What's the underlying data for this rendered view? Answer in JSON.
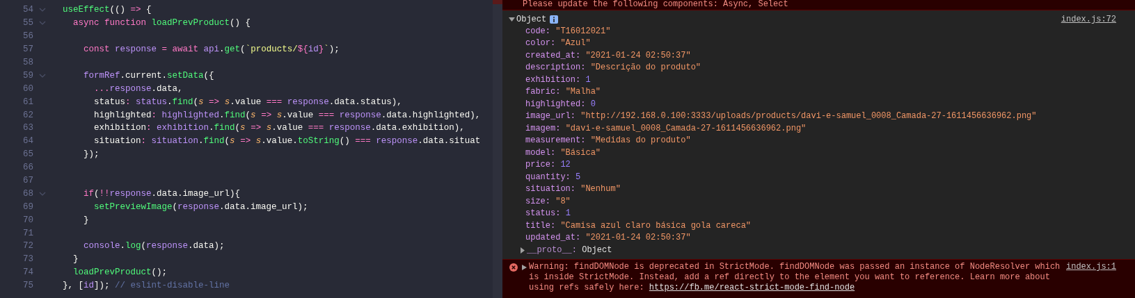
{
  "editor": {
    "lines": [
      {
        "number": "54",
        "foldable": true,
        "tokens": [
          {
            "kind": "func",
            "text": "useEffect"
          },
          {
            "kind": "plain",
            "text": "(() "
          },
          {
            "kind": "keyword",
            "text": "=>"
          },
          {
            "kind": "plain",
            "text": " {"
          }
        ]
      },
      {
        "number": "55",
        "foldable": true,
        "tokens": [
          {
            "kind": "keyword",
            "text": "  async function"
          },
          {
            "kind": "func",
            "text": " loadPrevProduct"
          },
          {
            "kind": "plain",
            "text": "() {"
          }
        ]
      },
      {
        "number": "56",
        "foldable": false
      },
      {
        "number": "57",
        "foldable": false,
        "tokens": [
          {
            "kind": "keyword",
            "text": "    const"
          },
          {
            "kind": "var",
            "text": " response"
          },
          {
            "kind": "keyword",
            "text": " ="
          },
          {
            "kind": "keyword",
            "text": " await"
          },
          {
            "kind": "var",
            "text": " api"
          },
          {
            "kind": "plain",
            "text": "."
          },
          {
            "kind": "func",
            "text": "get"
          },
          {
            "kind": "plain",
            "text": "("
          },
          {
            "kind": "string",
            "text": "`products/"
          },
          {
            "kind": "keyword",
            "text": "${"
          },
          {
            "kind": "var",
            "text": "id"
          },
          {
            "kind": "keyword",
            "text": "}"
          },
          {
            "kind": "string",
            "text": "`"
          },
          {
            "kind": "plain",
            "text": ");"
          }
        ]
      },
      {
        "number": "58",
        "foldable": false
      },
      {
        "number": "59",
        "foldable": true,
        "tokens": [
          {
            "kind": "var",
            "text": "    formRef"
          },
          {
            "kind": "plain",
            "text": ".current."
          },
          {
            "kind": "func",
            "text": "setData"
          },
          {
            "kind": "plain",
            "text": "({"
          }
        ]
      },
      {
        "number": "60",
        "foldable": false,
        "tokens": [
          {
            "kind": "keyword",
            "text": "      ..."
          },
          {
            "kind": "var",
            "text": "response"
          },
          {
            "kind": "plain",
            "text": ".data,"
          }
        ]
      },
      {
        "number": "61",
        "foldable": false,
        "tokens": [
          {
            "kind": "plain",
            "text": "      status"
          },
          {
            "kind": "keyword",
            "text": ": "
          },
          {
            "kind": "var",
            "text": "status"
          },
          {
            "kind": "plain",
            "text": "."
          },
          {
            "kind": "func",
            "text": "find"
          },
          {
            "kind": "plain",
            "text": "("
          },
          {
            "kind": "param",
            "text": "s"
          },
          {
            "kind": "keyword",
            "text": " => "
          },
          {
            "kind": "param",
            "text": "s"
          },
          {
            "kind": "plain",
            "text": ".value "
          },
          {
            "kind": "keyword",
            "text": "==="
          },
          {
            "kind": "var",
            "text": " response"
          },
          {
            "kind": "plain",
            "text": ".data.status),"
          }
        ]
      },
      {
        "number": "62",
        "foldable": false,
        "tokens": [
          {
            "kind": "plain",
            "text": "      highlighted"
          },
          {
            "kind": "keyword",
            "text": ": "
          },
          {
            "kind": "var",
            "text": "highlighted"
          },
          {
            "kind": "plain",
            "text": "."
          },
          {
            "kind": "func",
            "text": "find"
          },
          {
            "kind": "plain",
            "text": "("
          },
          {
            "kind": "param",
            "text": "s"
          },
          {
            "kind": "keyword",
            "text": " => "
          },
          {
            "kind": "param",
            "text": "s"
          },
          {
            "kind": "plain",
            "text": ".value "
          },
          {
            "kind": "keyword",
            "text": "==="
          },
          {
            "kind": "var",
            "text": " response"
          },
          {
            "kind": "plain",
            "text": ".data.highlighted),"
          }
        ]
      },
      {
        "number": "63",
        "foldable": false,
        "tokens": [
          {
            "kind": "plain",
            "text": "      exhibition"
          },
          {
            "kind": "keyword",
            "text": ": "
          },
          {
            "kind": "var",
            "text": "exhibition"
          },
          {
            "kind": "plain",
            "text": "."
          },
          {
            "kind": "func",
            "text": "find"
          },
          {
            "kind": "plain",
            "text": "("
          },
          {
            "kind": "param",
            "text": "s"
          },
          {
            "kind": "keyword",
            "text": " => "
          },
          {
            "kind": "param",
            "text": "s"
          },
          {
            "kind": "plain",
            "text": ".value "
          },
          {
            "kind": "keyword",
            "text": "==="
          },
          {
            "kind": "var",
            "text": " response"
          },
          {
            "kind": "plain",
            "text": ".data.exhibition),"
          }
        ]
      },
      {
        "number": "64",
        "foldable": false,
        "tokens": [
          {
            "kind": "plain",
            "text": "      situation"
          },
          {
            "kind": "keyword",
            "text": ": "
          },
          {
            "kind": "var",
            "text": "situation"
          },
          {
            "kind": "plain",
            "text": "."
          },
          {
            "kind": "func",
            "text": "find"
          },
          {
            "kind": "plain",
            "text": "("
          },
          {
            "kind": "param",
            "text": "s"
          },
          {
            "kind": "keyword",
            "text": " => "
          },
          {
            "kind": "param",
            "text": "s"
          },
          {
            "kind": "plain",
            "text": ".value."
          },
          {
            "kind": "func",
            "text": "toString"
          },
          {
            "kind": "plain",
            "text": "() "
          },
          {
            "kind": "keyword",
            "text": "==="
          },
          {
            "kind": "var",
            "text": " response"
          },
          {
            "kind": "plain",
            "text": ".data.situat"
          }
        ]
      },
      {
        "number": "65",
        "foldable": false,
        "tokens": [
          {
            "kind": "plain",
            "text": "    });"
          }
        ]
      },
      {
        "number": "66",
        "foldable": false
      },
      {
        "number": "67",
        "foldable": false
      },
      {
        "number": "68",
        "foldable": true,
        "tokens": [
          {
            "kind": "keyword",
            "text": "    if"
          },
          {
            "kind": "plain",
            "text": "("
          },
          {
            "kind": "keyword",
            "text": "!!"
          },
          {
            "kind": "var",
            "text": "response"
          },
          {
            "kind": "plain",
            "text": ".data.image_url){"
          }
        ]
      },
      {
        "number": "69",
        "foldable": false,
        "tokens": [
          {
            "kind": "func",
            "text": "      setPreviewImage"
          },
          {
            "kind": "plain",
            "text": "("
          },
          {
            "kind": "var",
            "text": "response"
          },
          {
            "kind": "plain",
            "text": ".data.image_url);"
          }
        ]
      },
      {
        "number": "70",
        "foldable": false,
        "tokens": [
          {
            "kind": "plain",
            "text": "    }"
          }
        ]
      },
      {
        "number": "71",
        "foldable": false
      },
      {
        "number": "72",
        "foldable": false,
        "tokens": [
          {
            "kind": "var",
            "text": "    console"
          },
          {
            "kind": "plain",
            "text": "."
          },
          {
            "kind": "func",
            "text": "log"
          },
          {
            "kind": "plain",
            "text": "("
          },
          {
            "kind": "var",
            "text": "response"
          },
          {
            "kind": "plain",
            "text": ".data);"
          }
        ]
      },
      {
        "number": "73",
        "foldable": false,
        "tokens": [
          {
            "kind": "plain",
            "text": "  }"
          }
        ]
      },
      {
        "number": "74",
        "foldable": false,
        "tokens": [
          {
            "kind": "func",
            "text": "  loadPrevProduct"
          },
          {
            "kind": "plain",
            "text": "();"
          }
        ]
      },
      {
        "number": "75",
        "foldable": false,
        "tokens": [
          {
            "kind": "plain",
            "text": "}, ["
          },
          {
            "kind": "var",
            "text": "id"
          },
          {
            "kind": "plain",
            "text": "]); "
          },
          {
            "kind": "comment",
            "text": "// eslint-disable-line"
          }
        ]
      }
    ]
  },
  "console": {
    "top_error": "Please update the following components: Async, Select",
    "object": {
      "label": "Object",
      "expanded": true,
      "source": "index.js:72",
      "properties": [
        {
          "key": "code:",
          "value": "\"T16012021\"",
          "kind": "string"
        },
        {
          "key": "color:",
          "value": "\"Azul\"",
          "kind": "string"
        },
        {
          "key": "created_at:",
          "value": "\"2021-01-24 02:50:37\"",
          "kind": "string"
        },
        {
          "key": "description:",
          "value": "\"Descrição do produto\"",
          "kind": "string"
        },
        {
          "key": "exhibition:",
          "value": "1",
          "kind": "number"
        },
        {
          "key": "fabric:",
          "value": "\"Malha\"",
          "kind": "string"
        },
        {
          "key": "highlighted:",
          "value": "0",
          "kind": "number"
        },
        {
          "key": "image_url:",
          "value": "\"http://192.168.0.100:3333/uploads/products/davi-e-samuel_0008_Camada-27-1611456636962.png\"",
          "kind": "string"
        },
        {
          "key": "imagem:",
          "value": "\"davi-e-samuel_0008_Camada-27-1611456636962.png\"",
          "kind": "string"
        },
        {
          "key": "measurement:",
          "value": "\"Medidas do produto\"",
          "kind": "string"
        },
        {
          "key": "model:",
          "value": "\"Básica\"",
          "kind": "string"
        },
        {
          "key": "price:",
          "value": "12",
          "kind": "number"
        },
        {
          "key": "quantity:",
          "value": "5",
          "kind": "number"
        },
        {
          "key": "situation:",
          "value": "\"Nenhum\"",
          "kind": "string"
        },
        {
          "key": "size:",
          "value": "\"8\"",
          "kind": "string"
        },
        {
          "key": "status:",
          "value": "1",
          "kind": "number"
        },
        {
          "key": "title:",
          "value": "\"Camisa azul claro básica gola careca\"",
          "kind": "string"
        },
        {
          "key": "updated_at:",
          "value": "\"2021-01-24 02:50:37\"",
          "kind": "string"
        }
      ],
      "proto": {
        "key": "__proto__:",
        "value": "Object",
        "expanded": false
      }
    },
    "warning": {
      "expanded": false,
      "text": "Warning: findDOMNode is deprecated in StrictMode. findDOMNode was passed an instance of NodeResolver which is inside StrictMode. Instead, add a ref directly to the element you want to reference. Learn more about using refs safely here: ",
      "link": "https://fb.me/react-strict-mode-find-node",
      "source": "index.js:1"
    }
  }
}
